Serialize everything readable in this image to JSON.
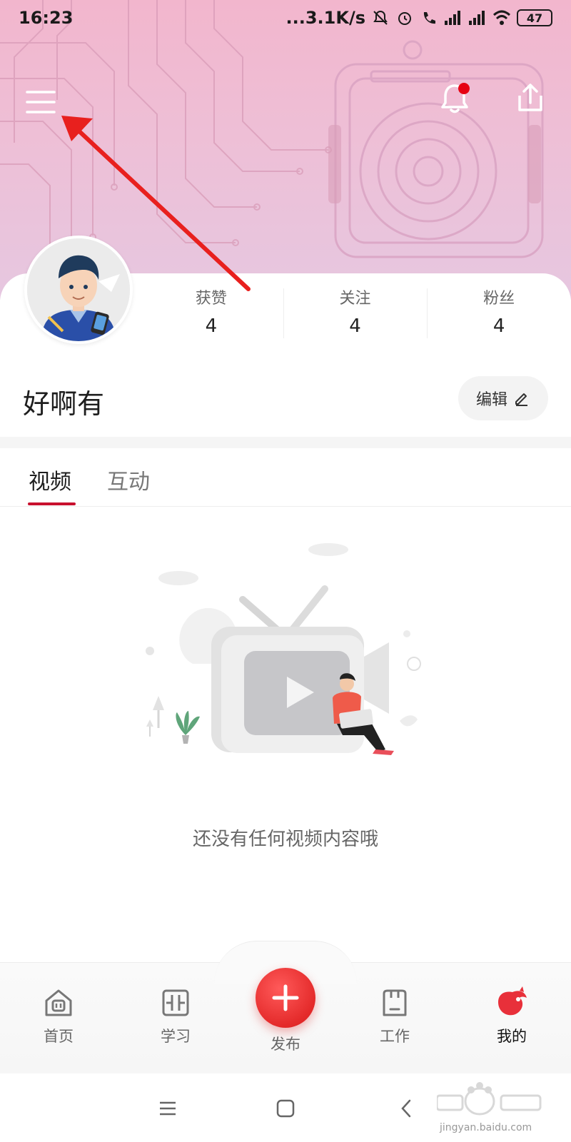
{
  "status_bar": {
    "time": "16:23",
    "network_speed": "...3.1K/s",
    "battery": "47",
    "icons": [
      "mute-icon",
      "alarm-icon",
      "call-icon",
      "signal-icon",
      "hd-signal-icon",
      "wifi-icon",
      "battery-icon"
    ]
  },
  "header": {
    "menu_icon": "hamburger-menu-icon",
    "notification_icon": "bell-icon",
    "share_icon": "share-icon",
    "notification_dot_color": "#e60012"
  },
  "profile": {
    "username": "好啊有",
    "edit_label": "编辑",
    "stats": [
      {
        "label": "获赞",
        "value": "4"
      },
      {
        "label": "关注",
        "value": "4"
      },
      {
        "label": "粉丝",
        "value": "4"
      }
    ]
  },
  "tabs": [
    {
      "label": "视频",
      "active": true
    },
    {
      "label": "互动",
      "active": false
    }
  ],
  "empty_state": {
    "message": "还没有任何视频内容哦"
  },
  "bottom_nav": {
    "items": [
      {
        "label": "首页",
        "icon": "home-icon"
      },
      {
        "label": "学习",
        "icon": "book-icon"
      },
      {
        "label": "发布",
        "icon": "plus-icon"
      },
      {
        "label": "工作",
        "icon": "work-icon"
      },
      {
        "label": "我的",
        "icon": "bird-logo-icon",
        "active": true
      }
    ]
  },
  "watermark": {
    "text": "jingyan.baidu.com"
  },
  "colors": {
    "accent": "#c8102e",
    "publish": "#e42a2a",
    "banner_top": "#f2b6cd",
    "banner_bottom": "#e6c7e0"
  }
}
